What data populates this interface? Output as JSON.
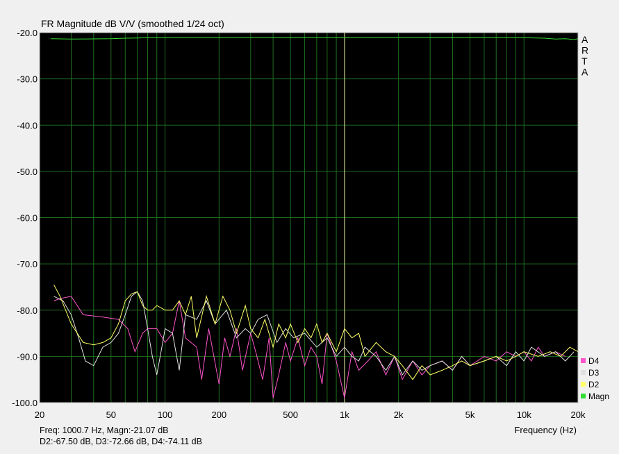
{
  "chart_data": {
    "type": "line",
    "title": "FR Magnitude dB V/V (smoothed 1/24 oct)",
    "xlabel": "Frequency (Hz)",
    "ylabel": "",
    "x_scale": "log",
    "xlim": [
      20,
      20000
    ],
    "ylim": [
      -100,
      -20
    ],
    "x_ticks": [
      20,
      50,
      100,
      200,
      500,
      1000,
      2000,
      5000,
      10000,
      20000
    ],
    "x_tick_labels": [
      "20",
      "50",
      "100",
      "200",
      "500",
      "1k",
      "2k",
      "5k",
      "10k",
      "20k"
    ],
    "y_ticks": [
      -20,
      -30,
      -40,
      -50,
      -60,
      -70,
      -80,
      -90,
      -100
    ],
    "y_tick_labels": [
      "-20.0",
      "-30.0",
      "-40.0",
      "-50.0",
      "-60.0",
      "-70.0",
      "-80.0",
      "-90.0",
      "-100.0"
    ],
    "grid": true,
    "background": "#000000",
    "grid_color": "#1e6e1e",
    "side_label": [
      "A",
      "R",
      "T",
      "A"
    ],
    "cursor": {
      "x": 1000.7,
      "color": "#e8e8a0"
    },
    "legend": {
      "placement": "bottom-right"
    },
    "series": [
      {
        "name": "D4",
        "color": "#ff55cc",
        "x": [
          24,
          26,
          30,
          35,
          45,
          55,
          62,
          68,
          75,
          80,
          90,
          100,
          110,
          120,
          130,
          150,
          160,
          175,
          185,
          200,
          215,
          230,
          250,
          270,
          300,
          320,
          350,
          380,
          400,
          430,
          470,
          500,
          550,
          600,
          650,
          700,
          750,
          800,
          900,
          1000,
          1100,
          1200,
          1350,
          1500,
          1700,
          1900,
          2100,
          2400,
          2700,
          3000,
          3500,
          4000,
          4500,
          5000,
          5500,
          6000,
          7000,
          8000,
          9000,
          10000,
          11000,
          12000,
          13000,
          15000,
          17000
        ],
        "y": [
          -78,
          -77.5,
          -77,
          -81,
          -81.5,
          -82,
          -84,
          -89,
          -85,
          -84,
          -84,
          -87,
          -85,
          -78,
          -86,
          -88,
          -95,
          -84,
          -89,
          -96,
          -86,
          -90,
          -84,
          -93,
          -85,
          -89,
          -95,
          -86,
          -99,
          -94,
          -87,
          -91,
          -86,
          -92,
          -88,
          -90,
          -96,
          -85,
          -91,
          -99,
          -89,
          -93,
          -91,
          -89,
          -94,
          -90,
          -95,
          -91,
          -94,
          -92,
          -91,
          -93,
          -90,
          -92,
          -91,
          -90,
          -91,
          -89,
          -90,
          -89,
          -91,
          -88,
          -90,
          -89,
          -90
        ]
      },
      {
        "name": "D3",
        "color": "#e0e0e0",
        "x": [
          24,
          27,
          30,
          33,
          36,
          40,
          45,
          50,
          55,
          60,
          65,
          70,
          75,
          80,
          85,
          90,
          95,
          100,
          110,
          120,
          130,
          150,
          170,
          190,
          220,
          250,
          280,
          300,
          330,
          370,
          420,
          470,
          520,
          600,
          700,
          800,
          900,
          1000,
          1100,
          1200,
          1300,
          1500,
          1700,
          1900,
          2100,
          2400,
          2700,
          3000,
          3500,
          4000,
          4500,
          5000,
          6000,
          7000,
          8000,
          9000,
          10000,
          11000,
          13000,
          15000,
          17000,
          19000
        ],
        "y": [
          -77,
          -78,
          -81,
          -86,
          -91,
          -92,
          -88,
          -87,
          -85,
          -81,
          -77,
          -76,
          -78,
          -84,
          -90,
          -94,
          -89,
          -84,
          -85,
          -93,
          -81,
          -82,
          -78,
          -83,
          -80,
          -86,
          -84,
          -85,
          -82,
          -81,
          -87,
          -84,
          -86,
          -85,
          -88,
          -86,
          -90,
          -88,
          -90,
          -91,
          -88,
          -90,
          -93,
          -90,
          -94,
          -91,
          -93,
          -92,
          -91,
          -93,
          -90,
          -92,
          -91,
          -90,
          -92,
          -89,
          -91,
          -88,
          -90,
          -89,
          -91,
          -89
        ]
      },
      {
        "name": "D2",
        "color": "#ffff66",
        "x": [
          24,
          26,
          30,
          35,
          40,
          45,
          50,
          55,
          60,
          65,
          70,
          75,
          80,
          85,
          90,
          100,
          110,
          120,
          130,
          140,
          150,
          170,
          190,
          210,
          230,
          250,
          280,
          300,
          330,
          360,
          400,
          430,
          470,
          500,
          550,
          600,
          650,
          700,
          750,
          800,
          900,
          1000,
          1100,
          1200,
          1300,
          1500,
          1700,
          1900,
          2100,
          2400,
          2700,
          3000,
          3500,
          4000,
          4500,
          5000,
          6000,
          7000,
          8000,
          9000,
          10000,
          12000,
          14000,
          16000,
          18000,
          20000
        ],
        "y": [
          -74.5,
          -77,
          -83,
          -87,
          -87.5,
          -87,
          -86,
          -83,
          -78,
          -76.5,
          -76,
          -79,
          -80,
          -80,
          -79,
          -80,
          -80,
          -78,
          -81,
          -77,
          -86,
          -77,
          -83,
          -77,
          -80,
          -85,
          -79,
          -84,
          -86,
          -82,
          -88,
          -83,
          -86,
          -83,
          -87,
          -84,
          -86,
          -83,
          -87,
          -85,
          -89,
          -84,
          -86,
          -85,
          -90,
          -87,
          -89,
          -90,
          -92,
          -95,
          -92,
          -94,
          -93,
          -92,
          -91,
          -92,
          -91,
          -90,
          -91,
          -90,
          -89,
          -90,
          -89,
          -90,
          -88,
          -89
        ]
      },
      {
        "name": "Magn",
        "color": "#33dd33",
        "x": [
          23,
          30,
          40,
          50,
          60,
          70,
          80,
          100,
          150,
          200,
          300,
          500,
          700,
          1000,
          1500,
          2000,
          3000,
          5000,
          7000,
          10000,
          13000,
          15000,
          17000,
          19000,
          20000
        ],
        "y": [
          -21.3,
          -21.4,
          -21.35,
          -21.3,
          -21.2,
          -21.15,
          -21.1,
          -21.1,
          -21.05,
          -21.1,
          -21.05,
          -21.1,
          -21.05,
          -21.07,
          -21.1,
          -21.05,
          -21.1,
          -21.1,
          -21.05,
          -21.1,
          -21.2,
          -21.4,
          -21.3,
          -21.5,
          -21.3
        ]
      }
    ]
  },
  "readout": {
    "line1": "Freq: 1000.7 Hz, Magn:-21.07 dB",
    "line2": "D2:-67.50 dB, D3:-72.66 dB, D4:-74.11 dB"
  }
}
